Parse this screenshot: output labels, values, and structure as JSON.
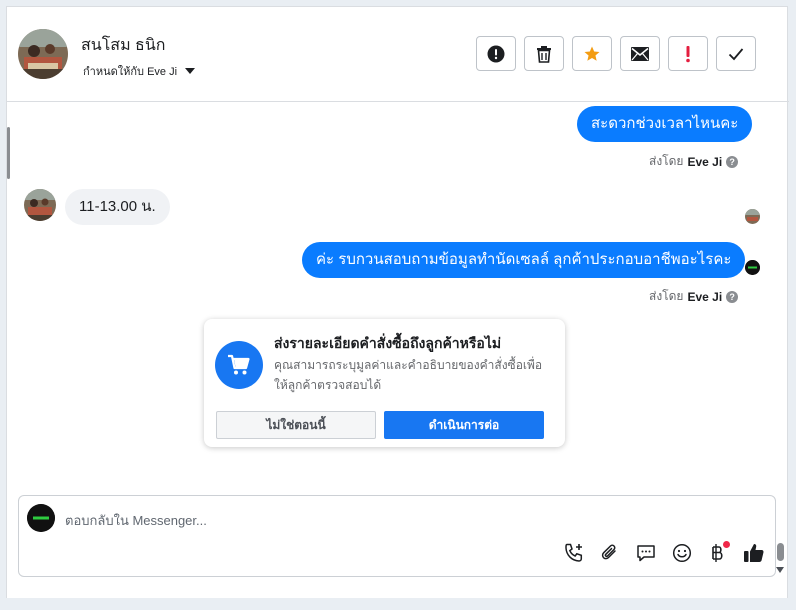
{
  "header": {
    "contact_name": "สนโสม ธนิก",
    "assign_label": "กำหนดให้กับ Eve Ji",
    "actions": [
      {
        "name": "report-spam-button",
        "icon": "exclamation-circle-icon"
      },
      {
        "name": "delete-button",
        "icon": "trash-icon"
      },
      {
        "name": "star-button",
        "icon": "star-icon"
      },
      {
        "name": "mark-unread-button",
        "icon": "envelope-icon"
      },
      {
        "name": "follow-up-button",
        "icon": "exclamation-icon"
      },
      {
        "name": "mark-done-button",
        "icon": "check-icon"
      }
    ]
  },
  "messages": [
    {
      "direction": "out",
      "text": "สะดวกช่วงเวลาไหนคะ",
      "sent_by_label": "ส่งโดย",
      "sent_by_name": "Eve Ji"
    },
    {
      "direction": "in",
      "text": "11-13.00 น."
    },
    {
      "direction": "out",
      "text": "ค่ะ รบกวนสอบถามข้อมูลทำนัดเซลล์ ลุกค้าประกอบอาชีพอะไรคะ",
      "sent_by_label": "ส่งโดย",
      "sent_by_name": "Eve Ji"
    }
  ],
  "order_prompt": {
    "title": "ส่งรายละเอียดคำสั่งซื้อถึงลูกค้าหรือไม่",
    "description": "คุณสามารถระบุมูลค่าและคำอธิบายของคำสั่งซื้อเพื่อให้ลูกค้าตรวจสอบได้",
    "not_now_label": "ไม่ใช่ตอนนี้",
    "continue_label": "ดำเนินการต่อ"
  },
  "composer": {
    "placeholder": "ตอบกลับใน Messenger...",
    "tools": [
      "phone-plus-icon",
      "paperclip-icon",
      "chat-bubble-icon",
      "smiley-icon",
      "baht-icon",
      "thumbs-up-icon"
    ]
  },
  "colors": {
    "accent": "#1877f2",
    "bubble_out": "#0a7cff",
    "star": "#f39c12",
    "alert_red": "#e41e3f"
  }
}
